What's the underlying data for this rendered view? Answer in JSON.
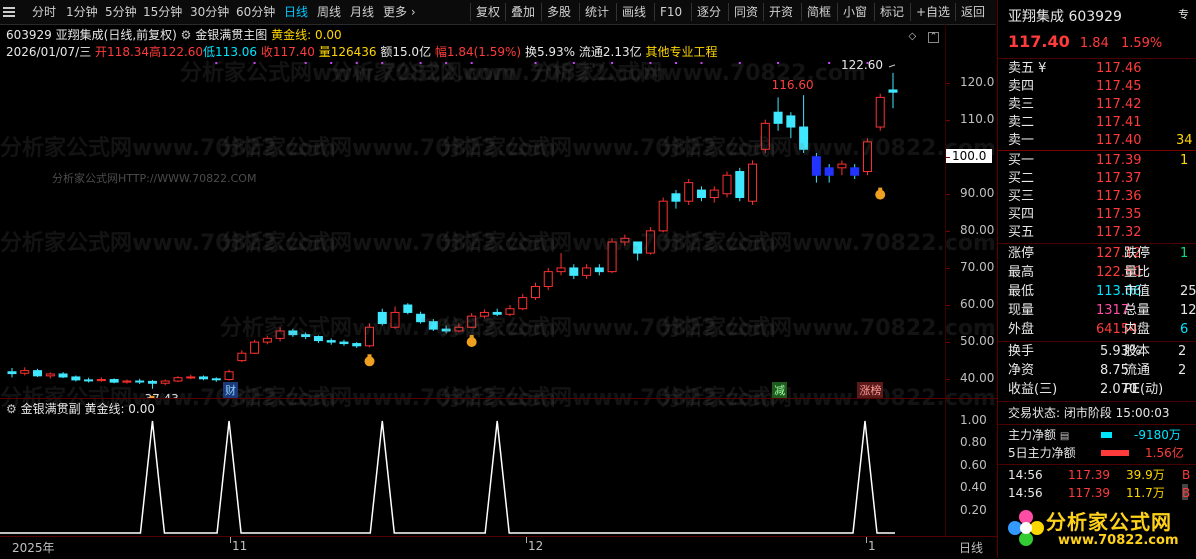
{
  "toolbar": {
    "periods": [
      "分时",
      "1分钟",
      "5分钟",
      "15分钟",
      "30分钟",
      "60分钟",
      "日线",
      "周线",
      "月线",
      "更多 ›"
    ],
    "active_period": "日线",
    "tools": [
      "复权",
      "叠加",
      "多股",
      "统计",
      "画线",
      "F10",
      "逐分",
      "同资",
      "开资",
      "简框",
      "小窗",
      "标记",
      "+自选",
      "返回"
    ]
  },
  "header": {
    "code": "603929",
    "name": "亚翔集成",
    "mode": "(日线,前复权)",
    "indicator": "金银满贯主图",
    "indicator_value": "黄金线: 0.00",
    "date": "2026/01/07/三",
    "open": "开118.34",
    "high": "高122.60",
    "low": "低113.06",
    "close": "收117.40",
    "volume": "量126436",
    "amount": "额15.0亿",
    "change": "幅1.84(1.59%)",
    "turnover": "换5.93%",
    "float": "流通2.13亿",
    "industry": "其他专业工程"
  },
  "watermark": {
    "site": "分析家公式网",
    "url": "www.70822.com",
    "small": "分析家公式网HTTP://WWW.70822.COM"
  },
  "chart_data": {
    "type": "candlestick",
    "yaxis_ticks": [
      "120.0",
      "110.0",
      "100.0",
      "90.00",
      "80.00",
      "70.00",
      "60.00",
      "50.00",
      "40.00"
    ],
    "ylim": [
      36,
      125
    ],
    "price_highlight": "100.0",
    "annotations": [
      "116.60",
      "122.60",
      "37.43"
    ],
    "markers": {
      "cai": "财",
      "jian": "减",
      "zhangbang": "涨榜"
    },
    "x_labels": [
      "2025年",
      "11",
      "12",
      "1"
    ],
    "candles": [
      [
        42.0,
        41.5,
        43.0,
        40.5
      ],
      [
        41.6,
        42.3,
        43.2,
        41.0
      ],
      [
        42.3,
        40.9,
        42.8,
        40.6
      ],
      [
        40.9,
        41.4,
        41.8,
        40.2
      ],
      [
        41.4,
        40.6,
        41.9,
        40.3
      ],
      [
        40.6,
        39.8,
        41.0,
        39.4
      ],
      [
        39.8,
        39.6,
        40.4,
        39.1
      ],
      [
        39.6,
        39.9,
        40.5,
        39.3
      ],
      [
        39.9,
        39.2,
        40.2,
        38.9
      ],
      [
        39.2,
        39.5,
        39.9,
        38.8
      ],
      [
        39.5,
        39.4,
        40.1,
        38.7
      ],
      [
        39.4,
        38.9,
        39.8,
        37.4
      ],
      [
        38.9,
        39.5,
        39.9,
        38.4
      ],
      [
        39.5,
        40.4,
        40.8,
        39.2
      ],
      [
        40.4,
        40.6,
        41.2,
        40.0
      ],
      [
        40.6,
        40.1,
        41.0,
        39.7
      ],
      [
        40.1,
        39.9,
        40.5,
        39.3
      ],
      [
        39.9,
        42.0,
        42.6,
        39.6
      ],
      [
        45.0,
        47.0,
        47.8,
        44.6
      ],
      [
        47.0,
        50.0,
        50.6,
        46.8
      ],
      [
        50.0,
        51.0,
        51.6,
        49.4
      ],
      [
        51.0,
        53.0,
        54.0,
        50.2
      ],
      [
        53.0,
        52.0,
        53.6,
        51.4
      ],
      [
        52.0,
        51.5,
        52.6,
        50.8
      ],
      [
        51.5,
        50.4,
        51.8,
        49.8
      ],
      [
        50.4,
        50.0,
        51.0,
        49.3
      ],
      [
        50.0,
        49.6,
        50.6,
        49.0
      ],
      [
        49.6,
        49.0,
        50.0,
        48.4
      ],
      [
        49.0,
        54.0,
        55.0,
        48.6
      ],
      [
        58.0,
        55.0,
        59.0,
        54.5
      ],
      [
        54.0,
        58.0,
        59.6,
        53.6
      ],
      [
        60.0,
        58.0,
        60.5,
        57.5
      ],
      [
        57.5,
        55.5,
        58.2,
        55.0
      ],
      [
        55.5,
        53.5,
        56.2,
        53.0
      ],
      [
        53.5,
        53.0,
        54.4,
        52.4
      ],
      [
        53.0,
        54.0,
        55.0,
        52.6
      ],
      [
        54.0,
        57.0,
        57.8,
        53.8
      ],
      [
        57.0,
        58.0,
        58.8,
        56.4
      ],
      [
        58.0,
        57.5,
        59.0,
        57.0
      ],
      [
        57.5,
        59.0,
        60.0,
        57.0
      ],
      [
        59.0,
        62.0,
        63.0,
        58.6
      ],
      [
        62.0,
        65.0,
        66.0,
        61.4
      ],
      [
        65.0,
        69.0,
        70.0,
        64.0
      ],
      [
        69.0,
        70.0,
        74.0,
        68.0
      ],
      [
        70.0,
        68.0,
        71.0,
        67.0
      ],
      [
        68.0,
        70.0,
        71.0,
        67.0
      ],
      [
        70.0,
        69.0,
        71.0,
        68.0
      ],
      [
        69.0,
        77.0,
        78.0,
        68.6
      ],
      [
        77.0,
        78.0,
        79.0,
        76.0
      ],
      [
        77.0,
        74.0,
        77.0,
        72.0
      ],
      [
        74.0,
        80.0,
        81.0,
        73.6
      ],
      [
        80.0,
        88.0,
        89.0,
        79.6
      ],
      [
        90.0,
        88.0,
        91.0,
        86.0
      ],
      [
        88.0,
        93.0,
        94.0,
        87.0
      ],
      [
        91.0,
        89.0,
        92.0,
        88.0
      ],
      [
        89.0,
        91.0,
        92.0,
        87.6
      ],
      [
        90.0,
        95.0,
        96.0,
        89.0
      ],
      [
        96.0,
        89.0,
        97.0,
        88.0
      ],
      [
        88.0,
        98.0,
        99.0,
        87.0
      ],
      [
        102.0,
        109.0,
        110.0,
        101.0
      ],
      [
        112.0,
        109.0,
        116.0,
        107.0
      ],
      [
        111.0,
        108.0,
        112.0,
        105.0
      ],
      [
        108.0,
        102.0,
        116.6,
        101.0
      ],
      [
        100.0,
        95.0,
        101.0,
        93.0
      ],
      [
        97.0,
        95.0,
        98.0,
        93.0
      ],
      [
        97.0,
        98.0,
        99.0,
        95.0
      ],
      [
        97.0,
        95.0,
        98.0,
        94.0
      ],
      [
        96.0,
        104.0,
        105.0,
        95.0
      ],
      [
        108.0,
        116.0,
        117.0,
        107.0
      ],
      [
        118.0,
        117.4,
        122.6,
        113.06
      ]
    ],
    "sub_indicator": "金银满贯副",
    "sub_value": "黄金线: 0.00",
    "sub_yaxis_ticks": [
      "1.00",
      "0.80",
      "0.60",
      "0.40",
      "0.20"
    ],
    "sub_spikes": [
      11,
      17,
      29,
      38,
      70
    ]
  },
  "quote": {
    "name": "亚翔集成",
    "code": "603929",
    "price": "117.40",
    "change": "1.84",
    "pct": "1.59%",
    "sells": [
      {
        "label": "卖五 ¥",
        "price": "117.46",
        "vol": ""
      },
      {
        "label": "卖四",
        "price": "117.45",
        "vol": ""
      },
      {
        "label": "卖三",
        "price": "117.42",
        "vol": ""
      },
      {
        "label": "卖二",
        "price": "117.41",
        "vol": ""
      },
      {
        "label": "卖一",
        "price": "117.40",
        "vol": "34"
      }
    ],
    "buys": [
      {
        "label": "买一",
        "price": "117.39",
        "vol": "1"
      },
      {
        "label": "买二",
        "price": "117.37",
        "vol": ""
      },
      {
        "label": "买三",
        "price": "117.36",
        "vol": ""
      },
      {
        "label": "买四",
        "price": "117.35",
        "vol": ""
      },
      {
        "label": "买五",
        "price": "117.32",
        "vol": ""
      }
    ],
    "stats": [
      {
        "l1": "涨停",
        "v1": "127.12",
        "c1": "red",
        "l2": "跌停",
        "v2": "1",
        "c2": "green"
      },
      {
        "l1": "最高",
        "v1": "122.60",
        "c1": "red",
        "l2": "量比",
        "v2": "",
        "c2": "white"
      },
      {
        "l1": "最低",
        "v1": "113.06",
        "c1": "cyan",
        "l2": "市值",
        "v2": "25",
        "c2": "white"
      },
      {
        "l1": "现量",
        "v1": "1317",
        "c1": "pink",
        "l2": "总量",
        "v2": "12",
        "c2": "white"
      },
      {
        "l1": "外盘",
        "v1": "64154",
        "c1": "red",
        "l2": "内盘",
        "v2": "6",
        "c2": "cyan"
      }
    ],
    "stats2": [
      {
        "l1": "换手",
        "v1": "5.93%",
        "l2": "股本",
        "v2": "2"
      },
      {
        "l1": "净资",
        "v1": "8.75",
        "l2": "流通",
        "v2": "2"
      },
      {
        "l1": "收益(三)",
        "v1": "2.070",
        "l2": "PE(动)",
        "v2": ""
      }
    ],
    "trade_status": "交易状态: 闭市阶段 15:00:03",
    "main_net_label": "主力净额",
    "main_net_value": "-9180万",
    "five_day_label": "5日主力净额",
    "five_day_value": "1.56亿",
    "ticks": [
      {
        "time": "14:56",
        "price": "117.39",
        "vol": "39.9万",
        "flag": "B"
      },
      {
        "time": "14:56",
        "price": "117.39",
        "vol": "11.7万",
        "flag": "B"
      }
    ],
    "logo_text": "分析家公式网",
    "logo_url": "www.70822.com",
    "side_tab": "专"
  }
}
